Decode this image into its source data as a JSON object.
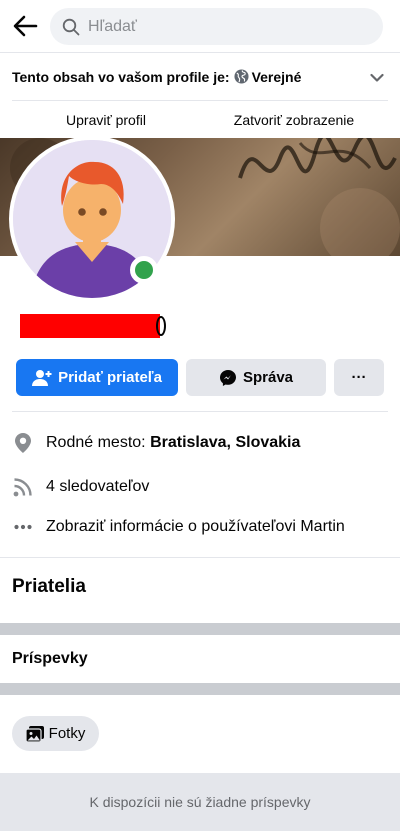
{
  "search": {
    "placeholder": "Hľadať"
  },
  "privacy": {
    "label": "Tento obsah vo vašom profile je:",
    "value": "Verejné"
  },
  "profile_actions": {
    "edit": "Upraviť profil",
    "close": "Zatvoriť zobrazenie"
  },
  "buttons": {
    "add_friend": "Pridať priateľa",
    "message": "Správa",
    "more": "···"
  },
  "info": {
    "hometown_label": "Rodné mesto:",
    "hometown_value": "Bratislava, Slovakia",
    "followers": "4 sledovateľov",
    "about": "Zobraziť informácie o používateľovi Martin"
  },
  "sections": {
    "friends": "Priatelia",
    "posts": "Príspevky"
  },
  "photos": {
    "label": "Fotky"
  },
  "empty_state": "K dispozícii nie sú žiadne príspevky",
  "colors": {
    "primary": "#1877f2",
    "online": "#31a24c",
    "divider": "#c9ccd1",
    "redaction": "#ff0000"
  }
}
